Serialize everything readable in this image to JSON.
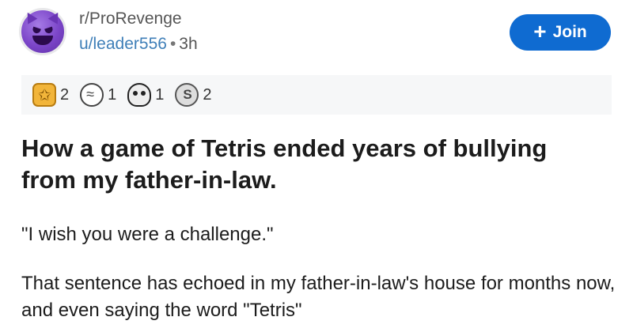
{
  "post": {
    "subreddit": "r/ProRevenge",
    "username": "u/leader556",
    "separator": "•",
    "time": "3h",
    "join_label": "Join",
    "join_icon": "plus-icon",
    "awards": [
      {
        "icon": "gold-award-icon",
        "count": "2"
      },
      {
        "icon": "brain-award-icon",
        "count": "1"
      },
      {
        "icon": "skull-award-icon",
        "count": "1"
      },
      {
        "icon": "silver-award-icon",
        "count": "2"
      }
    ],
    "title": "How a game of Tetris ended years of bullying from my father-in-law.",
    "body": [
      "\"I wish you were a challenge.\"",
      "That sentence has echoed in my father-in-law's house for months now, and even saying the word \"Tetris\""
    ]
  },
  "colors": {
    "join_bg": "#0f6bd1",
    "username": "#3f7fb8",
    "awards_bg": "#f6f7f8"
  }
}
